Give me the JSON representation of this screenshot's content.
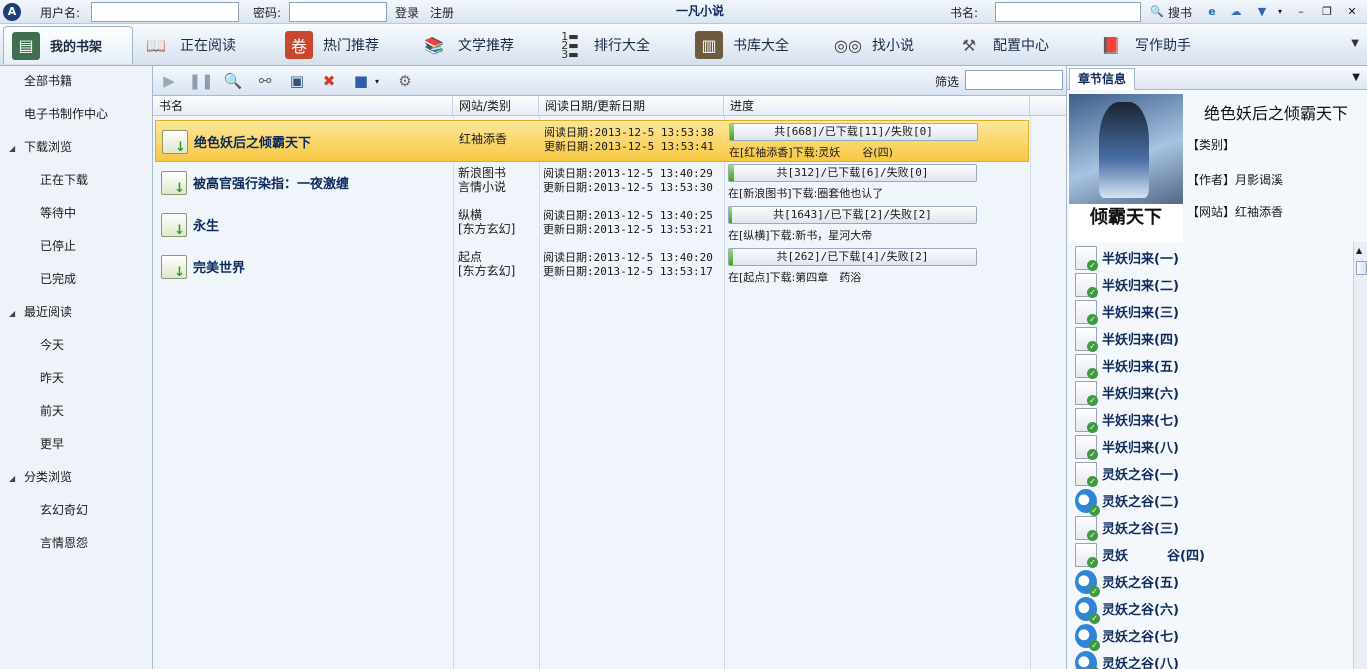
{
  "titlebar": {
    "username_label": "用户名:",
    "password_label": "密码:",
    "login": "登录",
    "register": "注册",
    "app_title": "一凡小说",
    "bookname_label": "书名:",
    "search": "搜书"
  },
  "nav": [
    {
      "label": "我的书架",
      "icon": "bookshelf-icon"
    },
    {
      "label": "正在阅读",
      "icon": "open-book-icon"
    },
    {
      "label": "热门推荐",
      "icon": "scroll-icon"
    },
    {
      "label": "文学推荐",
      "icon": "books-icon"
    },
    {
      "label": "排行大全",
      "icon": "ranking-icon"
    },
    {
      "label": "书库大全",
      "icon": "library-icon"
    },
    {
      "label": "找小说",
      "icon": "binoculars-icon"
    },
    {
      "label": "配置中心",
      "icon": "tools-icon"
    },
    {
      "label": "写作助手",
      "icon": "book-stack-icon"
    }
  ],
  "sidebar": {
    "all_books": "全部书籍",
    "ebook_center": "电子书制作中心",
    "download_browse": "下载浏览",
    "downloading": "正在下载",
    "waiting": "等待中",
    "stopped": "已停止",
    "completed": "已完成",
    "recent_reading": "最近阅读",
    "today": "今天",
    "yesterday": "昨天",
    "day_before": "前天",
    "earlier": "更早",
    "category_browse": "分类浏览",
    "fantasy": "玄幻奇幻",
    "romance": "言情恩怨"
  },
  "list": {
    "filter_label": "筛选",
    "columns": {
      "name": "书名",
      "site": "网站/类别",
      "dates": "阅读日期/更新日期",
      "progress": "进度"
    },
    "books": [
      {
        "title": "绝色妖后之倾霸天下",
        "site": "红袖添香",
        "category": "",
        "read": "阅读日期:2013-12-5 13:53:38",
        "updated": "更新日期:2013-12-5 13:53:41",
        "progress": "共[668]/已下载[11]/失败[0]",
        "fraction": 0.016,
        "status": "在[红袖添香]下载:灵妖　　谷(四)"
      },
      {
        "title": "被高官强行染指：一夜激缠",
        "site": "新浪图书",
        "category": "言情小说",
        "read": "阅读日期:2013-12-5 13:40:29",
        "updated": "更新日期:2013-12-5 13:53:30",
        "progress": "共[312]/已下载[6]/失败[0]",
        "fraction": 0.019,
        "status": "在[新浪图书]下载:圈套他也认了"
      },
      {
        "title": "永生",
        "site": "纵横",
        "category": "[东方玄幻]",
        "read": "阅读日期:2013-12-5 13:40:25",
        "updated": "更新日期:2013-12-5 13:53:21",
        "progress": "共[1643]/已下载[2]/失败[2]",
        "fraction": 0.0012,
        "status": "在[纵横]下载:新书，星河大帝"
      },
      {
        "title": "完美世界",
        "site": "起点",
        "category": "[东方玄幻]",
        "read": "阅读日期:2013-12-5 13:40:20",
        "updated": "更新日期:2013-12-5 13:53:17",
        "progress": "共[262]/已下载[4]/失败[2]",
        "fraction": 0.015,
        "status": "在[起点]下载:第四章　药浴"
      }
    ]
  },
  "info": {
    "tab": "章节信息",
    "cover_text": "倾霸天下",
    "title": "绝色妖后之倾霸天下",
    "category": "【类别】",
    "author": "【作者】月影谒溪",
    "website": "【网站】红袖添香"
  },
  "chapters": [
    {
      "title": "半妖归来(一)",
      "icon": "page"
    },
    {
      "title": "半妖归来(二)",
      "icon": "page"
    },
    {
      "title": "半妖归来(三)",
      "icon": "page"
    },
    {
      "title": "半妖归来(四)",
      "icon": "page"
    },
    {
      "title": "半妖归来(五)",
      "icon": "page"
    },
    {
      "title": "半妖归来(六)",
      "icon": "page"
    },
    {
      "title": "半妖归来(七)",
      "icon": "page"
    },
    {
      "title": "半妖归来(八)",
      "icon": "page"
    },
    {
      "title": "灵妖之谷(一)",
      "icon": "page"
    },
    {
      "title": "灵妖之谷(二)",
      "icon": "ie"
    },
    {
      "title": "灵妖之谷(三)",
      "icon": "page"
    },
    {
      "title": "灵妖　　　谷(四)",
      "icon": "page"
    },
    {
      "title": "灵妖之谷(五)",
      "icon": "ie"
    },
    {
      "title": "灵妖之谷(六)",
      "icon": "ie"
    },
    {
      "title": "灵妖之谷(七)",
      "icon": "ie"
    },
    {
      "title": "灵妖之谷(八)",
      "icon": "ie"
    }
  ],
  "colors": {
    "accent": "#f7c843",
    "title_text": "#0e2a5c",
    "progress_green": "#3f9f2a"
  }
}
